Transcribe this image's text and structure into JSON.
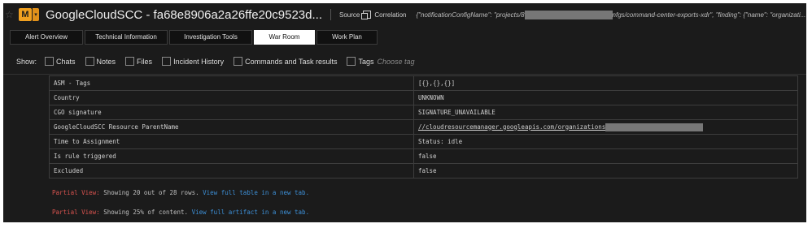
{
  "header": {
    "badge": "M",
    "badge_arrow": "▾",
    "title": "GoogleCloudSCC - fa68e8906a2a26ffe20c9523d...",
    "source_label": "Source",
    "source_value": "Correlation",
    "json_prefix": "{\"notificationConfigName\": \"projects/8",
    "json_suffix": "nfgs/command-center-exports-xdr\", \"finding\": {\"name\": \"organizati..."
  },
  "tabs": [
    {
      "label": "Alert Overview",
      "active": false
    },
    {
      "label": "Technical Information",
      "active": false
    },
    {
      "label": "Investigation Tools",
      "active": false
    },
    {
      "label": "War Room",
      "active": true
    },
    {
      "label": "Work Plan",
      "active": false
    }
  ],
  "filters": {
    "show_label": "Show:",
    "items": [
      "Chats",
      "Notes",
      "Files",
      "Incident History",
      "Commands and Task results",
      "Tags"
    ],
    "choose_tag": "Choose tag"
  },
  "table": {
    "rows": [
      {
        "key": "ASM - Tags",
        "value": "[{},{},{}]"
      },
      {
        "key": "Country",
        "value": "UNKNOWN"
      },
      {
        "key": "CGO signature",
        "value": "SIGNATURE_UNAVAILABLE"
      },
      {
        "key": "GoogleCloudSCC Resource ParentName",
        "value": "//cloudresourcemanager.googleapis.com/organizations"
      },
      {
        "key": "Time to Assignment",
        "value": "Status: idle"
      },
      {
        "key": "Is rule triggered",
        "value": "false"
      },
      {
        "key": "Excluded",
        "value": "false"
      }
    ]
  },
  "notices": [
    {
      "prefix": "Partial View:",
      "text": " Showing 20 out of 28 rows. ",
      "link": "View full table in a new tab."
    },
    {
      "prefix": "Partial View:",
      "text": " Showing 25% of content. ",
      "link": "View full artifact in a new tab."
    }
  ]
}
